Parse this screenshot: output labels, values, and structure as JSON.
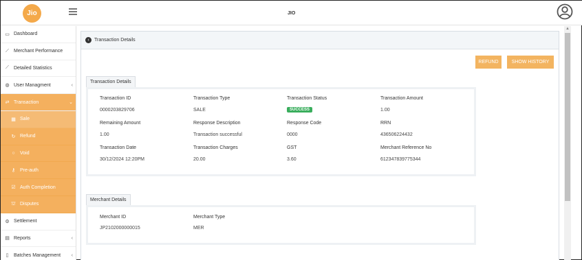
{
  "app": {
    "logo_text": "Jio",
    "title": "JIO"
  },
  "sidebar": {
    "items": [
      {
        "label": "Dashboard",
        "icon": "monitor-icon"
      },
      {
        "label": "Merchant Performance",
        "icon": "chart-line-icon"
      },
      {
        "label": "Detailed Statistics",
        "icon": "chart-line-icon"
      },
      {
        "label": "User Managment",
        "icon": "user-circle-icon",
        "chevron": "‹"
      },
      {
        "label": "Transaction",
        "icon": "exchange-icon",
        "chevron": "⌄"
      },
      {
        "label": "Sale",
        "icon": "grid-icon"
      },
      {
        "label": "Refund",
        "icon": "refresh-icon"
      },
      {
        "label": "Void",
        "icon": "circle-icon"
      },
      {
        "label": "Pre-auth",
        "icon": "key-icon"
      },
      {
        "label": "Auth Completion",
        "icon": "check-square-icon"
      },
      {
        "label": "Disputes",
        "icon": "bank-icon"
      },
      {
        "label": "Settlement",
        "icon": "settings-icon"
      },
      {
        "label": "Reports",
        "icon": "file-icon",
        "chevron": "‹"
      },
      {
        "label": "Batches Management",
        "icon": "document-icon",
        "chevron": "‹"
      }
    ]
  },
  "page": {
    "header": "Transaction Details"
  },
  "actions": {
    "refund": "REFUND",
    "show_history": "SHOW HISTORY"
  },
  "transaction": {
    "section_title": "Transaction Details",
    "fields": [
      {
        "label": "Transaction ID",
        "value": "0000203829706"
      },
      {
        "label": "Transaction Type",
        "value": "SALE"
      },
      {
        "label": "Transaction Status",
        "value": "SUCCESS"
      },
      {
        "label": "Transaction Amount",
        "value": "1.00"
      },
      {
        "label": "Remaining Amount",
        "value": "1.00"
      },
      {
        "label": "Response Description",
        "value": "Transaction successful"
      },
      {
        "label": "Response Code",
        "value": "0000"
      },
      {
        "label": "RRN",
        "value": "436506224432"
      },
      {
        "label": "Transaction Date",
        "value": "30/12/2024 12:20PM"
      },
      {
        "label": "Transaction Charges",
        "value": "20.00"
      },
      {
        "label": "GST",
        "value": "3.60"
      },
      {
        "label": "Merchant Reference No",
        "value": "612347839775344"
      }
    ]
  },
  "merchant": {
    "section_title": "Merchant Details",
    "fields": [
      {
        "label": "Merchant ID",
        "value": "JP2102000000015"
      },
      {
        "label": "Merchant Type",
        "value": "MER"
      }
    ]
  },
  "colors": {
    "accent": "#f4b05e",
    "success": "#3aae5d"
  }
}
